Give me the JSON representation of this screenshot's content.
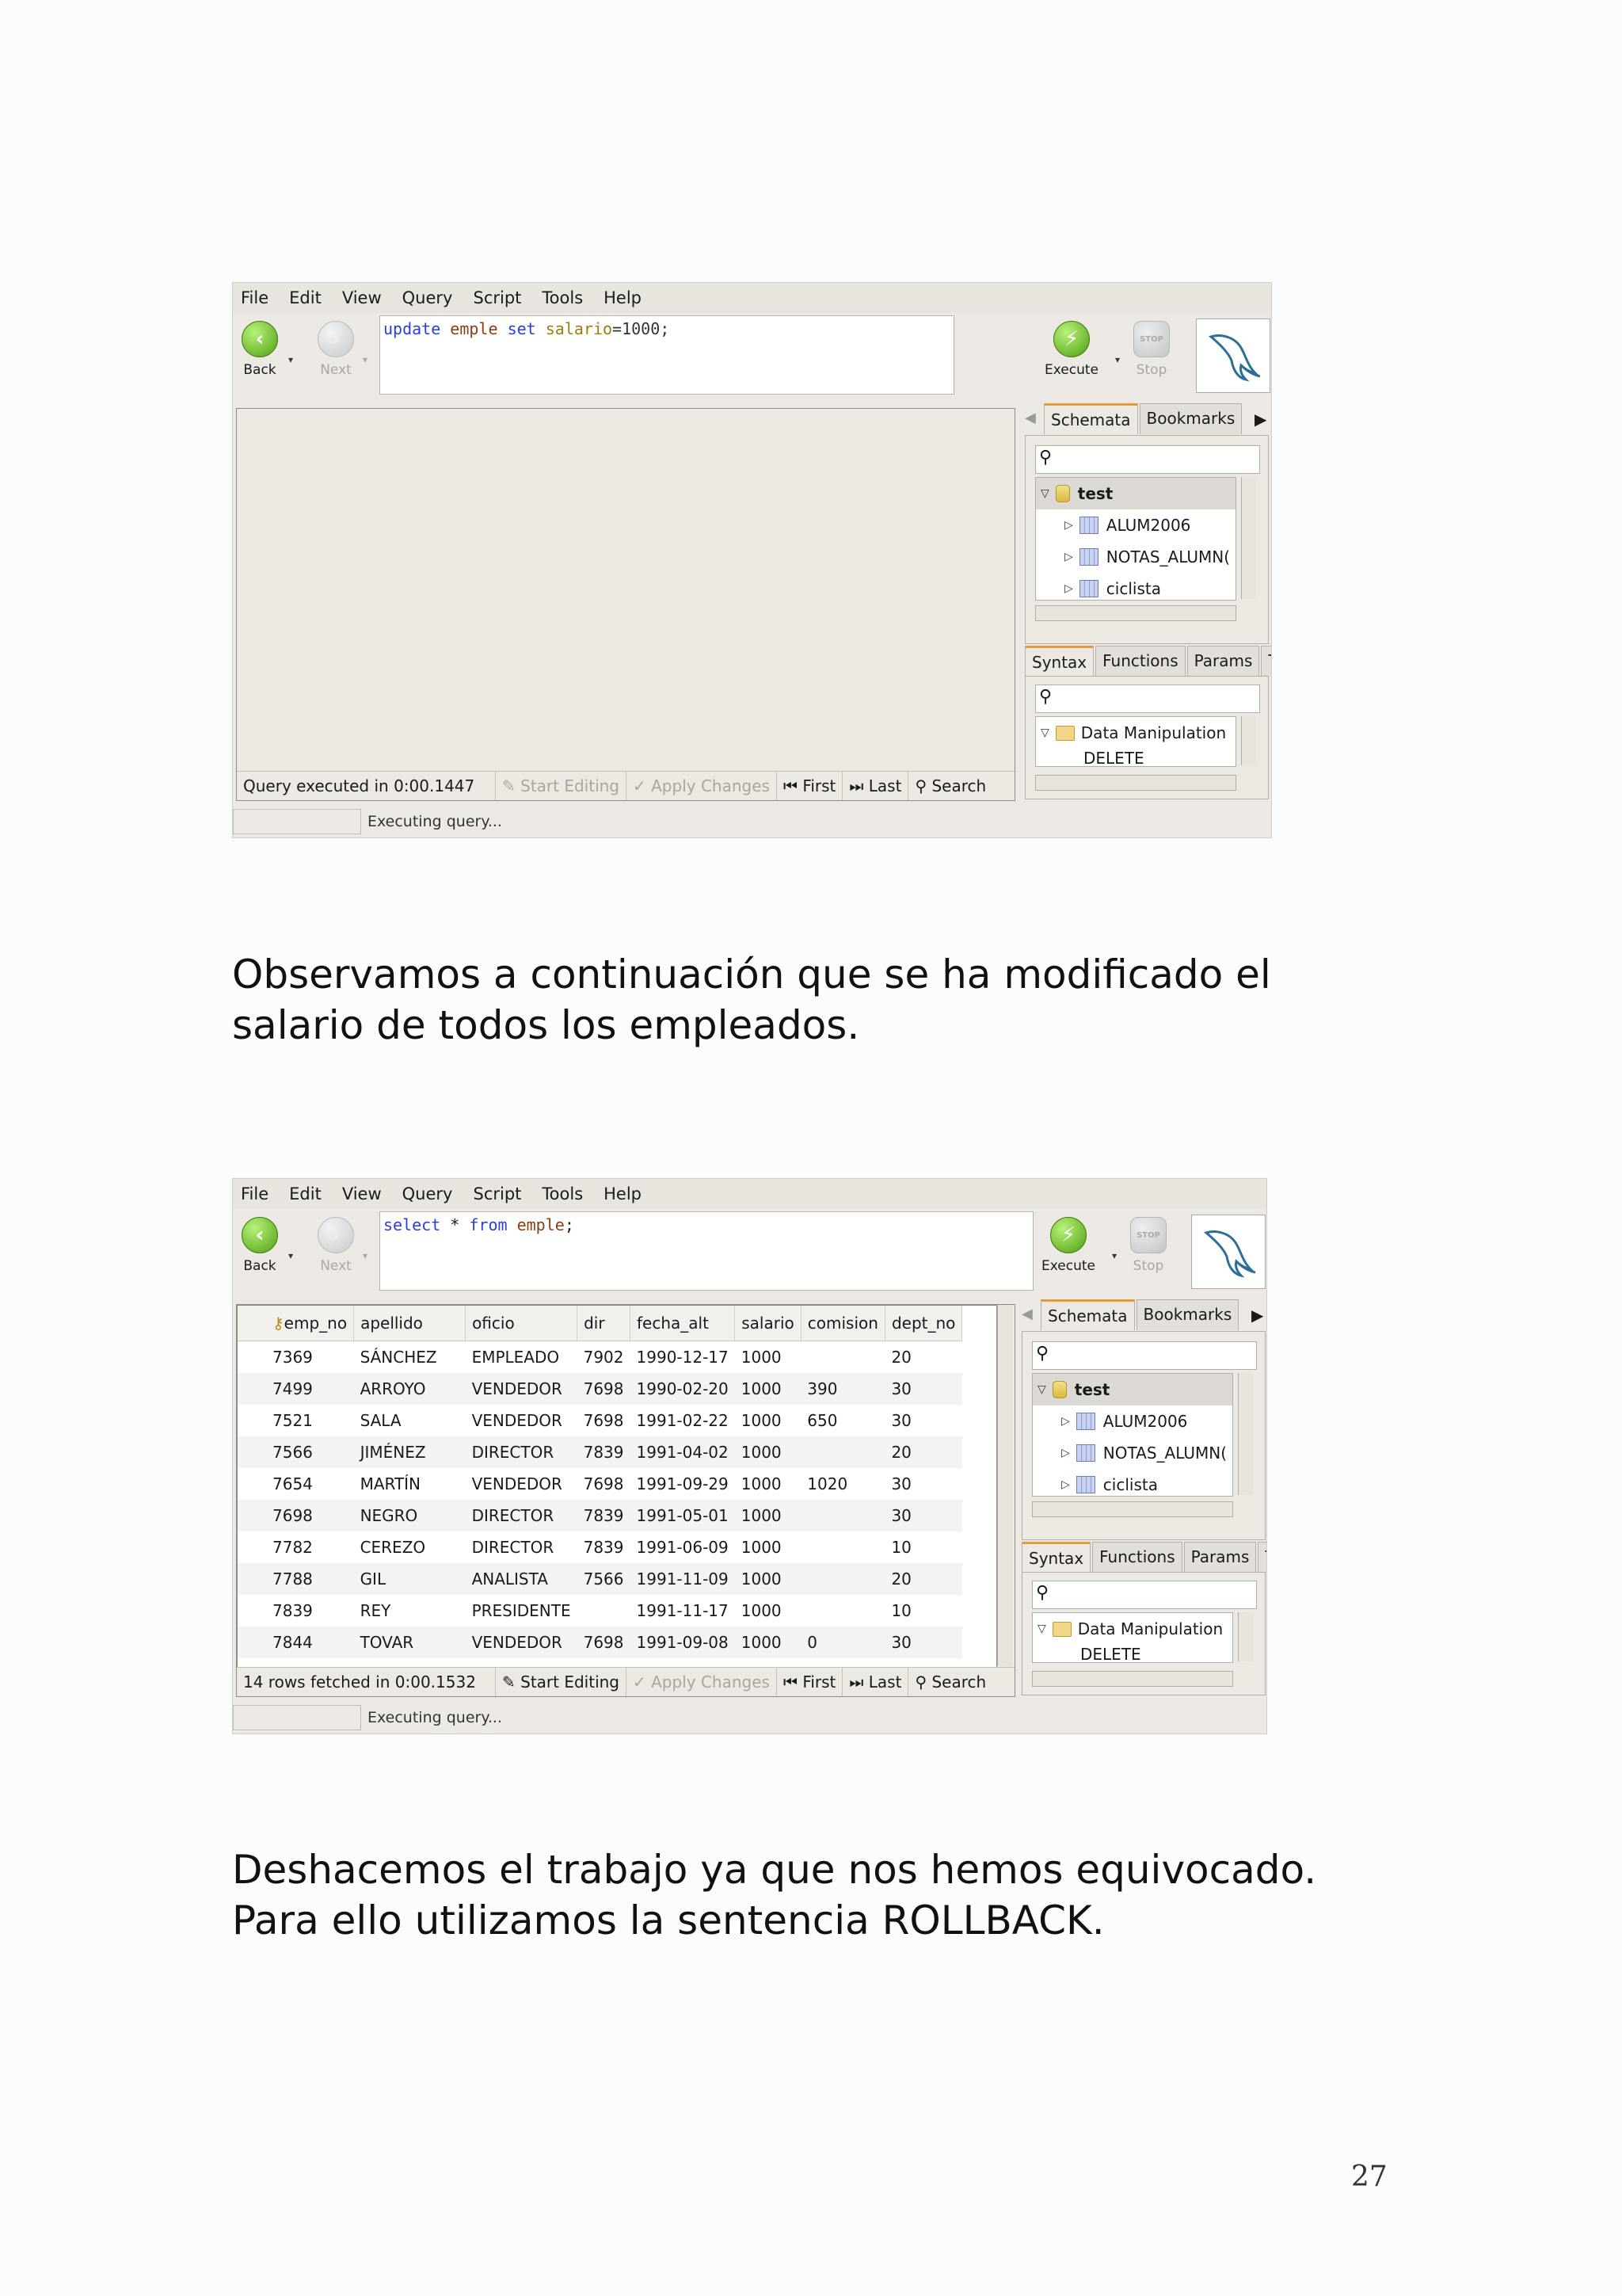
{
  "menu": [
    "File",
    "Edit",
    "View",
    "Query",
    "Script",
    "Tools",
    "Help"
  ],
  "toolbar": {
    "back": "Back",
    "next": "Next",
    "execute": "Execute",
    "stop": "Stop",
    "stop_badge": "STOP"
  },
  "screenshot1": {
    "sql": {
      "kw1": "update",
      "table": "emple",
      "kw2": "set",
      "col": "salario",
      "rest": "=1000;"
    },
    "footer": {
      "status": "Query executed in 0:00.1447",
      "start_editing": "Start Editing",
      "apply_changes": "Apply Changes",
      "first": "First",
      "last": "Last",
      "search": "Search"
    },
    "statusbar": "Executing query..."
  },
  "screenshot2": {
    "sql": {
      "kw1": "select",
      "mid": " * ",
      "kw2": "from",
      "table": "emple",
      "end": ";"
    },
    "columns": [
      "emp_no",
      "apellido",
      "oficio",
      "dir",
      "fecha_alt",
      "salario",
      "comision",
      "dept_no"
    ],
    "rows": [
      [
        "7369",
        "SÁNCHEZ",
        "EMPLEADO",
        "7902",
        "1990-12-17",
        "1000",
        "",
        "20"
      ],
      [
        "7499",
        "ARROYO",
        "VENDEDOR",
        "7698",
        "1990-02-20",
        "1000",
        "390",
        "30"
      ],
      [
        "7521",
        "SALA",
        "VENDEDOR",
        "7698",
        "1991-02-22",
        "1000",
        "650",
        "30"
      ],
      [
        "7566",
        "JIMÉNEZ",
        "DIRECTOR",
        "7839",
        "1991-04-02",
        "1000",
        "",
        "20"
      ],
      [
        "7654",
        "MARTÍN",
        "VENDEDOR",
        "7698",
        "1991-09-29",
        "1000",
        "1020",
        "30"
      ],
      [
        "7698",
        "NEGRO",
        "DIRECTOR",
        "7839",
        "1991-05-01",
        "1000",
        "",
        "30"
      ],
      [
        "7782",
        "CEREZO",
        "DIRECTOR",
        "7839",
        "1991-06-09",
        "1000",
        "",
        "10"
      ],
      [
        "7788",
        "GIL",
        "ANALISTA",
        "7566",
        "1991-11-09",
        "1000",
        "",
        "20"
      ],
      [
        "7839",
        "REY",
        "PRESIDENTE",
        "",
        "1991-11-17",
        "1000",
        "",
        "10"
      ],
      [
        "7844",
        "TOVAR",
        "VENDEDOR",
        "7698",
        "1991-09-08",
        "1000",
        "0",
        "30"
      ]
    ],
    "footer": {
      "status": "14 rows fetched in 0:00.1532",
      "start_editing": "Start Editing",
      "apply_changes": "Apply Changes",
      "first": "First",
      "last": "Last",
      "search": "Search"
    },
    "statusbar": "Executing query..."
  },
  "sidebar": {
    "tabs_top": [
      "Schemata",
      "Bookmarks"
    ],
    "tabs_bottom": [
      "Syntax",
      "Functions",
      "Params",
      "T"
    ],
    "schema": {
      "db": "test",
      "tables": [
        "ALUM2006",
        "NOTAS_ALUMN(",
        "ciclista"
      ]
    },
    "syntax": {
      "group": "Data Manipulation",
      "item": "DELETE"
    }
  },
  "text": {
    "caption1": "Observamos a continuación que se ha modificado el salario de todos los empleados.",
    "caption2": "Deshacemos el trabajo ya que nos hemos equivocado. Para ello utilizamos la sentencia ROLLBACK."
  },
  "page_number": "27"
}
